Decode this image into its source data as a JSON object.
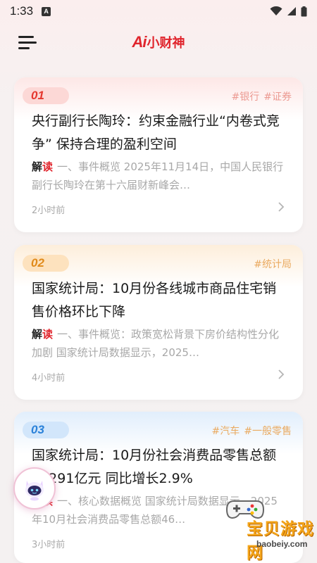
{
  "status_bar": {
    "time": "1:33",
    "notification_letter": "A"
  },
  "header": {
    "logo_ai": "Ai",
    "logo_name": "小财神"
  },
  "cards": [
    {
      "number": "01",
      "tags": [
        "#银行",
        "#证券"
      ],
      "title": "央行副行长陶玲：约束金融行业“内卷式竞争” 保持合理的盈利空间",
      "summary_label_a": "解",
      "summary_label_b": "读",
      "summary": "一、事件概览 2025年11月14日，中国人民银行副行长陶玲在第十六届财新峰会…",
      "time": "2小时前"
    },
    {
      "number": "02",
      "tags": [
        "#统计局"
      ],
      "title": "国家统计局：10月份各线城市商品住宅销售价格环比下降",
      "summary_label_a": "解",
      "summary_label_b": "读",
      "summary": "一、事件概览：政策宽松背景下房价结构性分化加剧 国家统计局数据显示，2025…",
      "time": "4小时前"
    },
    {
      "number": "03",
      "tags": [
        "#汽车",
        "#一般零售"
      ],
      "title": "国家统计局：10月份社会消费品零售总额46291亿元 同比增长2.9%",
      "summary_label_a": "解",
      "summary_label_b": "读",
      "summary": "一、核心数据概览 国家统计局数据显示，2025年10月社会消费品零售总额46…",
      "time": "3小时前"
    }
  ],
  "watermark": {
    "text": "宝贝游戏网",
    "url": "baobeiy.com"
  },
  "colors": {
    "brand": "#e0242c",
    "card1_accent": "#e5382f",
    "card2_accent": "#e08a1a",
    "card3_accent": "#2b82d9"
  },
  "icons": [
    "menu-icon",
    "wifi-icon",
    "signal-icon",
    "battery-icon",
    "chevron-right-icon",
    "robot-assistant-icon"
  ]
}
